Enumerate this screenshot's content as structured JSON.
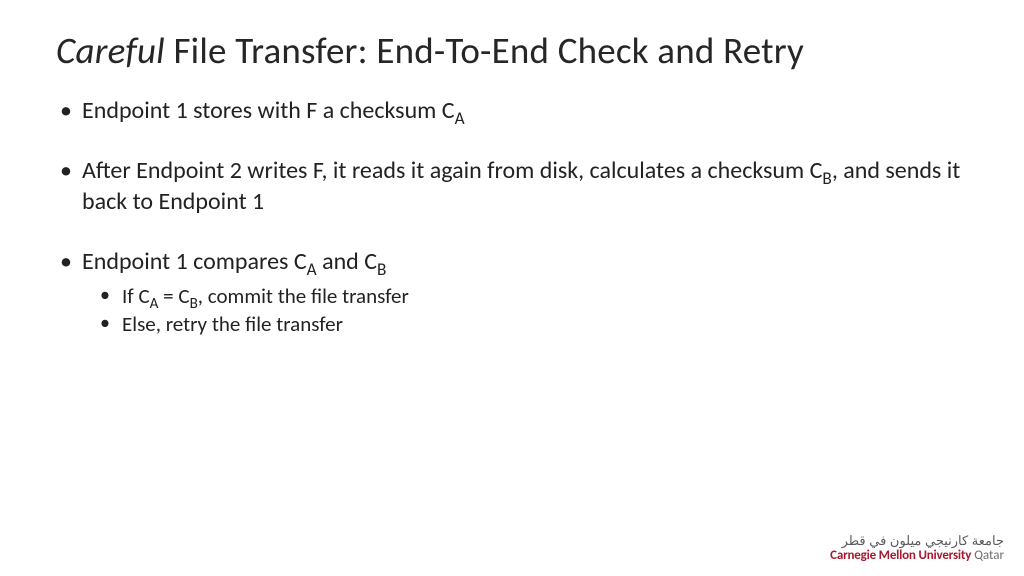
{
  "title": {
    "italic": "Careful",
    "rest": " File Transfer: End-To-End Check and Retry"
  },
  "bullets": {
    "b1_pre": "Endpoint 1 stores with F a checksum C",
    "b1_sub": "A",
    "b2_pre": "After Endpoint 2 writes F, it reads it again from disk, calculates a checksum C",
    "b2_sub": "B",
    "b2_post": ", and sends it back to Endpoint 1",
    "b3_pre": "Endpoint 1 compares C",
    "b3_subA": "A",
    "b3_mid": " and C",
    "b3_subB": "B",
    "b3_s1_pre": "If C",
    "b3_s1_subA": "A",
    "b3_s1_mid": " = C",
    "b3_s1_subB": "B",
    "b3_s1_post": ", commit the file transfer",
    "b3_s2": "Else, retry the file transfer"
  },
  "logo": {
    "arabic": "جامعة كارنيجي ميلون في قطر",
    "cmu": "Carnegie Mellon University",
    "qatar": "Qatar"
  }
}
